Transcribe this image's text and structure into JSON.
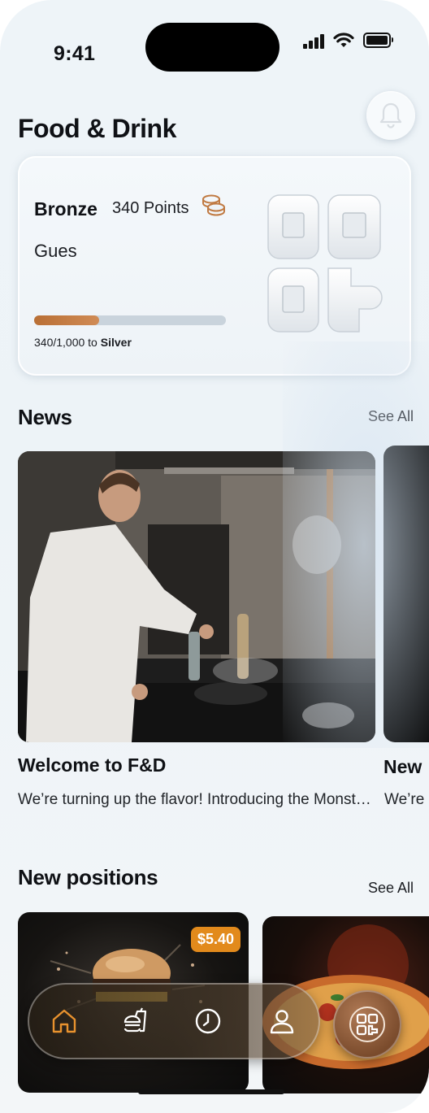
{
  "status_bar": {
    "time": "9:41"
  },
  "header": {
    "title": "Food & Drink",
    "bell_icon": "bell-icon"
  },
  "loyalty": {
    "tier": "Bronze",
    "points_text": "340 Points",
    "guest_name": "Gues",
    "progress_fraction": 0.34,
    "progress_current": "340/1,000 to",
    "progress_target": "Silver",
    "qr_icon": "qr-code-icon",
    "coins_icon": "coins-icon",
    "progress_color": "#c07a42"
  },
  "news": {
    "section_title": "News",
    "see_all": "See All",
    "items": [
      {
        "title": "Welcome to F&D",
        "description": "We’re turning up the flavor! Introducing the Monster Beef with Cheddar — a bold new creation"
      },
      {
        "title": "New",
        "description": "We’re Monst"
      }
    ]
  },
  "positions": {
    "section_title": "New positions",
    "see_all": "See All",
    "items": [
      {
        "price": "$5.40",
        "image": "burger"
      },
      {
        "image": "pizza"
      }
    ]
  },
  "nav": {
    "items": [
      "home-icon",
      "food-menu-icon",
      "history-clock-icon",
      "profile-icon"
    ],
    "fab": "qr-code-icon",
    "active_color": "#e8922e"
  }
}
